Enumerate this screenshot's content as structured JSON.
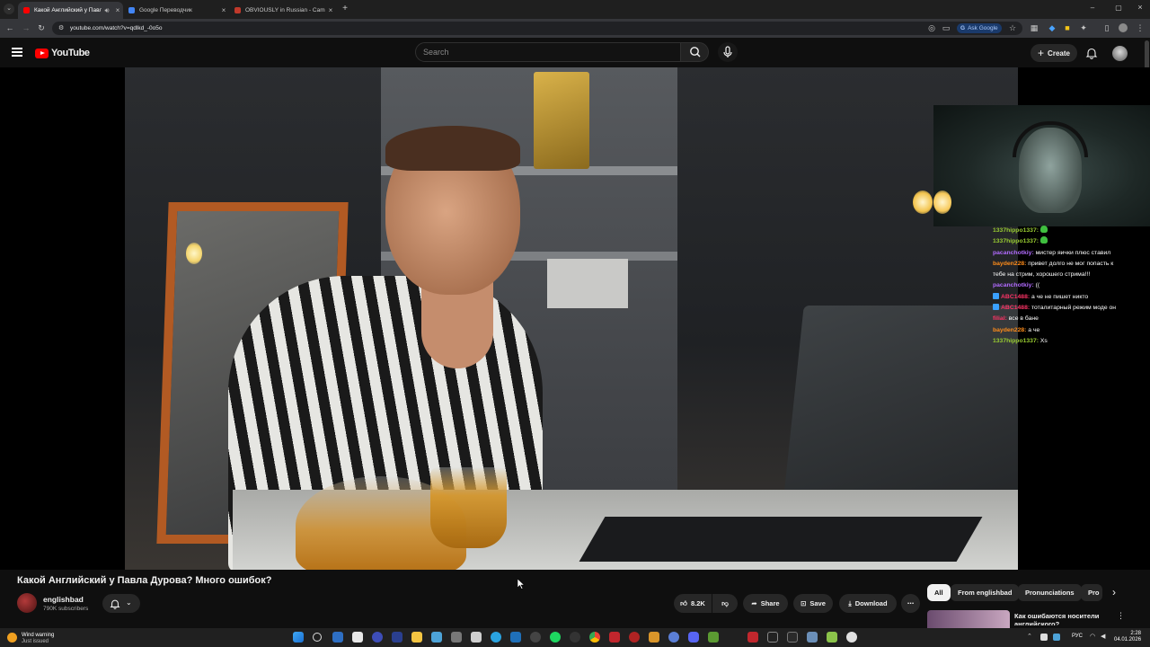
{
  "browser": {
    "tabs": [
      {
        "title": "Какой Английский у Павла",
        "active": true
      },
      {
        "title": "Google Переводчик",
        "active": false
      },
      {
        "title": "OBVIOUSLY in Russian - Camb",
        "active": false
      }
    ],
    "url": "youtube.com/watch?v=qdlkd_-0o5o",
    "ask_google": "Ask Google"
  },
  "header": {
    "logo": "YouTube",
    "search_placeholder": "Search",
    "create_label": "Create"
  },
  "chat": [
    {
      "user": "1337hippo1337:",
      "text": "",
      "color": "#9acd32",
      "emote": true
    },
    {
      "user": "1337hippo1337:",
      "text": "",
      "color": "#9acd32",
      "emote": true
    },
    {
      "user": "pacanchotkiy:",
      "text": "мистер яички плюс ставил",
      "color": "#b26bff"
    },
    {
      "user": "bayden228:",
      "text": "привет долго не мог попасть к",
      "color": "#ff8c1a"
    },
    {
      "user": "",
      "text": "тебе на стрим, хорошего стрима!!!",
      "color": "#ff8c1a"
    },
    {
      "user": "pacanchotkiy:",
      "text": "((",
      "color": "#b26bff"
    },
    {
      "user": "ABC1488:",
      "text": "а че не пишет никто",
      "color": "#ff3366",
      "badge": true
    },
    {
      "user": "ABC1488:",
      "text": "тоталитарный режим моде он",
      "color": "#ff3366",
      "badge": true
    },
    {
      "user": "filial:",
      "text": "все в бане",
      "color": "#ff3366"
    },
    {
      "user": "bayden228:",
      "text": "а че",
      "color": "#ff8c1a"
    },
    {
      "user": "1337hippo1337:",
      "text": "Xs",
      "color": "#9acd32"
    }
  ],
  "video": {
    "title": "Какой Английский у Павла Дурова? Много ошибок?",
    "channel": "englishbad",
    "subscribers": "790K subscribers",
    "likes": "8.2K",
    "share": "Share",
    "save": "Save",
    "download": "Download"
  },
  "chips": [
    {
      "label": "All",
      "selected": true
    },
    {
      "label": "From englishbad",
      "selected": false
    },
    {
      "label": "Pronunciations",
      "selected": false
    },
    {
      "label": "Pro",
      "selected": false
    }
  ],
  "recommendation": {
    "title": "Как ошибаются носители",
    "title2": "английского?"
  },
  "taskbar": {
    "weather_title": "Wind warning",
    "weather_sub": "Just issued",
    "lang": "РУС",
    "time": "2:28",
    "date": "04.01.2026"
  }
}
